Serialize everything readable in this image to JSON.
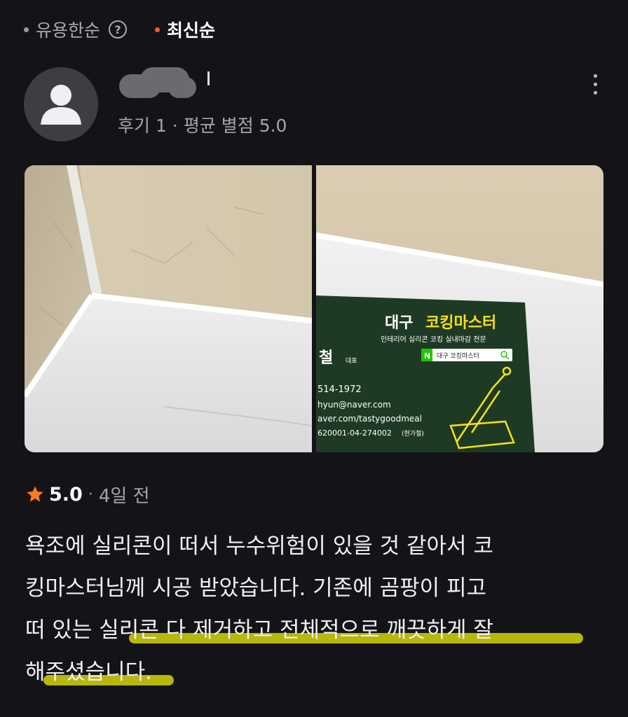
{
  "sort": {
    "options": [
      {
        "label": "유용한순",
        "active": false
      },
      {
        "label": "최신순",
        "active": true
      }
    ],
    "help_icon": "?"
  },
  "reviewer": {
    "review_count": "후기 1",
    "avg_rating": "평균 별점 5.0"
  },
  "photos": [
    {
      "alt": "bathtub-silicone-corner"
    },
    {
      "alt": "business-card-on-bathtub",
      "card": {
        "title_prefix": "대구",
        "title_main": "코킹마스터",
        "subtitle": "인테리어 실리콘 코킹 실내마감 전문",
        "search_badge": "N",
        "search_text": "대구 코킹마스터",
        "name": "철",
        "role": "대표",
        "phone": "514-1972",
        "email": "hyun@naver.com",
        "blog": "aver.com/tastygoodmeal",
        "account": "620001-04-274002",
        "account_holder": "(현가철)"
      }
    }
  ],
  "review": {
    "score": "5.0",
    "date": "4일 전",
    "lines": [
      "욕조에 실리콘이 떠서 누수위험이 있을 것 같아서 코",
      "킹마스터님께 시공 받았습니다. 기존에 곰팡이 피고",
      "떠 있는 실리콘 다 제거하고 전체적으로 깨끗하게 잘",
      "해주셨습니다."
    ]
  },
  "colors": {
    "background": "#141418",
    "accent": "#ff5a1f",
    "star": "#ff7a1a",
    "highlight": "#d4d40a",
    "card_green": "#1f3a24",
    "card_yellow": "#f2e21a"
  },
  "icons": {
    "sort_dot": "dot-icon",
    "help": "question-circle-icon",
    "avatar": "user-avatar-icon",
    "more": "more-vertical-icon",
    "star": "star-icon",
    "search": "search-icon",
    "caulking_gun": "caulking-gun-icon"
  }
}
